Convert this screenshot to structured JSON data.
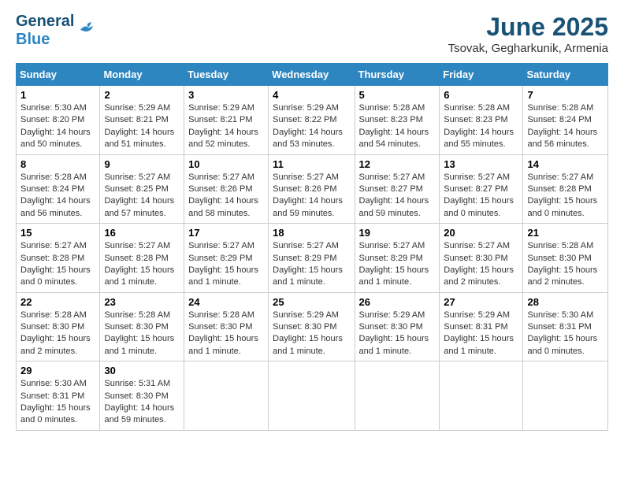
{
  "header": {
    "logo_line1": "General",
    "logo_line2": "Blue",
    "month": "June 2025",
    "location": "Tsovak, Gegharkunik, Armenia"
  },
  "days_of_week": [
    "Sunday",
    "Monday",
    "Tuesday",
    "Wednesday",
    "Thursday",
    "Friday",
    "Saturday"
  ],
  "weeks": [
    [
      {
        "day": "1",
        "info": "Sunrise: 5:30 AM\nSunset: 8:20 PM\nDaylight: 14 hours\nand 50 minutes."
      },
      {
        "day": "2",
        "info": "Sunrise: 5:29 AM\nSunset: 8:21 PM\nDaylight: 14 hours\nand 51 minutes."
      },
      {
        "day": "3",
        "info": "Sunrise: 5:29 AM\nSunset: 8:21 PM\nDaylight: 14 hours\nand 52 minutes."
      },
      {
        "day": "4",
        "info": "Sunrise: 5:29 AM\nSunset: 8:22 PM\nDaylight: 14 hours\nand 53 minutes."
      },
      {
        "day": "5",
        "info": "Sunrise: 5:28 AM\nSunset: 8:23 PM\nDaylight: 14 hours\nand 54 minutes."
      },
      {
        "day": "6",
        "info": "Sunrise: 5:28 AM\nSunset: 8:23 PM\nDaylight: 14 hours\nand 55 minutes."
      },
      {
        "day": "7",
        "info": "Sunrise: 5:28 AM\nSunset: 8:24 PM\nDaylight: 14 hours\nand 56 minutes."
      }
    ],
    [
      {
        "day": "8",
        "info": "Sunrise: 5:28 AM\nSunset: 8:24 PM\nDaylight: 14 hours\nand 56 minutes."
      },
      {
        "day": "9",
        "info": "Sunrise: 5:27 AM\nSunset: 8:25 PM\nDaylight: 14 hours\nand 57 minutes."
      },
      {
        "day": "10",
        "info": "Sunrise: 5:27 AM\nSunset: 8:26 PM\nDaylight: 14 hours\nand 58 minutes."
      },
      {
        "day": "11",
        "info": "Sunrise: 5:27 AM\nSunset: 8:26 PM\nDaylight: 14 hours\nand 59 minutes."
      },
      {
        "day": "12",
        "info": "Sunrise: 5:27 AM\nSunset: 8:27 PM\nDaylight: 14 hours\nand 59 minutes."
      },
      {
        "day": "13",
        "info": "Sunrise: 5:27 AM\nSunset: 8:27 PM\nDaylight: 15 hours\nand 0 minutes."
      },
      {
        "day": "14",
        "info": "Sunrise: 5:27 AM\nSunset: 8:28 PM\nDaylight: 15 hours\nand 0 minutes."
      }
    ],
    [
      {
        "day": "15",
        "info": "Sunrise: 5:27 AM\nSunset: 8:28 PM\nDaylight: 15 hours\nand 0 minutes."
      },
      {
        "day": "16",
        "info": "Sunrise: 5:27 AM\nSunset: 8:28 PM\nDaylight: 15 hours\nand 1 minute."
      },
      {
        "day": "17",
        "info": "Sunrise: 5:27 AM\nSunset: 8:29 PM\nDaylight: 15 hours\nand 1 minute."
      },
      {
        "day": "18",
        "info": "Sunrise: 5:27 AM\nSunset: 8:29 PM\nDaylight: 15 hours\nand 1 minute."
      },
      {
        "day": "19",
        "info": "Sunrise: 5:27 AM\nSunset: 8:29 PM\nDaylight: 15 hours\nand 1 minute."
      },
      {
        "day": "20",
        "info": "Sunrise: 5:27 AM\nSunset: 8:30 PM\nDaylight: 15 hours\nand 2 minutes."
      },
      {
        "day": "21",
        "info": "Sunrise: 5:28 AM\nSunset: 8:30 PM\nDaylight: 15 hours\nand 2 minutes."
      }
    ],
    [
      {
        "day": "22",
        "info": "Sunrise: 5:28 AM\nSunset: 8:30 PM\nDaylight: 15 hours\nand 2 minutes."
      },
      {
        "day": "23",
        "info": "Sunrise: 5:28 AM\nSunset: 8:30 PM\nDaylight: 15 hours\nand 1 minute."
      },
      {
        "day": "24",
        "info": "Sunrise: 5:28 AM\nSunset: 8:30 PM\nDaylight: 15 hours\nand 1 minute."
      },
      {
        "day": "25",
        "info": "Sunrise: 5:29 AM\nSunset: 8:30 PM\nDaylight: 15 hours\nand 1 minute."
      },
      {
        "day": "26",
        "info": "Sunrise: 5:29 AM\nSunset: 8:30 PM\nDaylight: 15 hours\nand 1 minute."
      },
      {
        "day": "27",
        "info": "Sunrise: 5:29 AM\nSunset: 8:31 PM\nDaylight: 15 hours\nand 1 minute."
      },
      {
        "day": "28",
        "info": "Sunrise: 5:30 AM\nSunset: 8:31 PM\nDaylight: 15 hours\nand 0 minutes."
      }
    ],
    [
      {
        "day": "29",
        "info": "Sunrise: 5:30 AM\nSunset: 8:31 PM\nDaylight: 15 hours\nand 0 minutes."
      },
      {
        "day": "30",
        "info": "Sunrise: 5:31 AM\nSunset: 8:30 PM\nDaylight: 14 hours\nand 59 minutes."
      },
      {
        "day": "",
        "info": ""
      },
      {
        "day": "",
        "info": ""
      },
      {
        "day": "",
        "info": ""
      },
      {
        "day": "",
        "info": ""
      },
      {
        "day": "",
        "info": ""
      }
    ]
  ]
}
